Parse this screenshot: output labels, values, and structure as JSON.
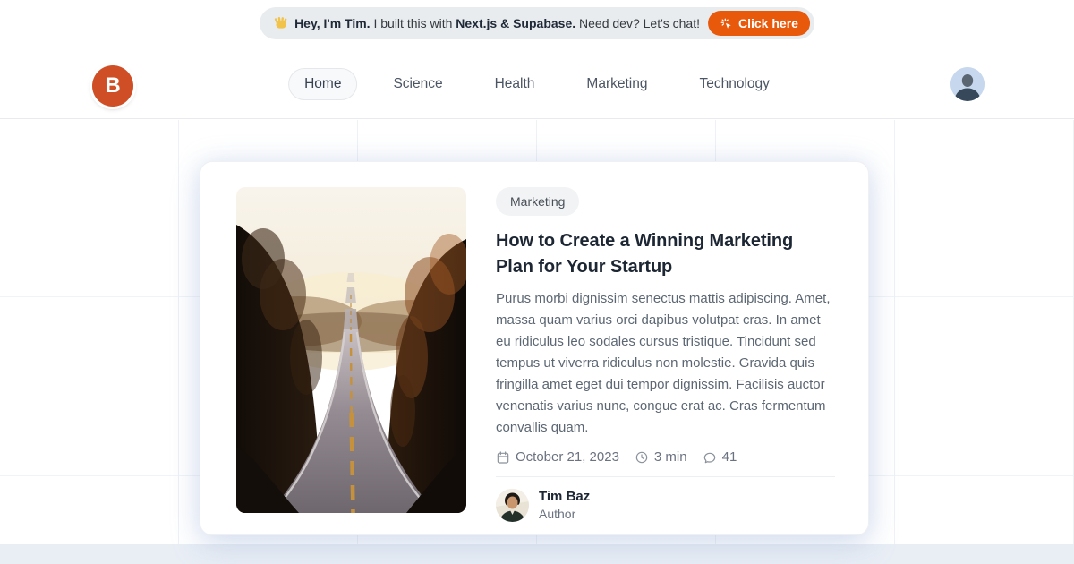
{
  "banner": {
    "wave_icon": "waving-hand",
    "intro_bold": "Hey, I'm Tim.",
    "mid_text": "I built this with",
    "tech_bold": "Next.js & Supabase.",
    "end_text": "Need dev? Let's chat!",
    "cta_label": "Click here",
    "cta_icon": "cursor-click"
  },
  "header": {
    "logo_letter": "B",
    "nav_items": [
      {
        "label": "Home",
        "active": true
      },
      {
        "label": "Science",
        "active": false
      },
      {
        "label": "Health",
        "active": false
      },
      {
        "label": "Marketing",
        "active": false
      },
      {
        "label": "Technology",
        "active": false
      }
    ],
    "user_avatar_icon": "person-silhouette"
  },
  "article": {
    "category": "Marketing",
    "title": "How to Create a Winning Marketing Plan for Your Startup",
    "excerpt": "Purus morbi dignissim senectus mattis adipiscing. Amet, massa quam varius orci dapibus volutpat cras. In amet eu ridiculus leo sodales cursus tristique. Tincidunt sed tempus ut viverra ridiculus non molestie. Gravida quis fringilla amet eget dui tempor dignissim. Facilisis auctor venenatis varius nunc, congue erat ac. Cras fermentum convallis quam.",
    "photo_alt_icon": "road-photo",
    "meta": {
      "date": "October 21, 2023",
      "date_icon": "calendar",
      "read_time": "3 min",
      "read_time_icon": "clock",
      "comments": "41",
      "comments_icon": "speech-bubble"
    },
    "author": {
      "name": "Tim Baz",
      "role": "Author",
      "avatar_icon": "author-photo"
    }
  },
  "colors": {
    "cta_orange": "#e8590c",
    "logo_orange": "#cf4e25",
    "banner_bg": "#e9ecef",
    "badge_bg": "#f1f3f5",
    "title_text": "#1d2633",
    "body_text": "#5c6773",
    "muted_text": "#6b7280",
    "card_glow": "#94acd8",
    "avatar_bg": "#c7d7ee"
  }
}
